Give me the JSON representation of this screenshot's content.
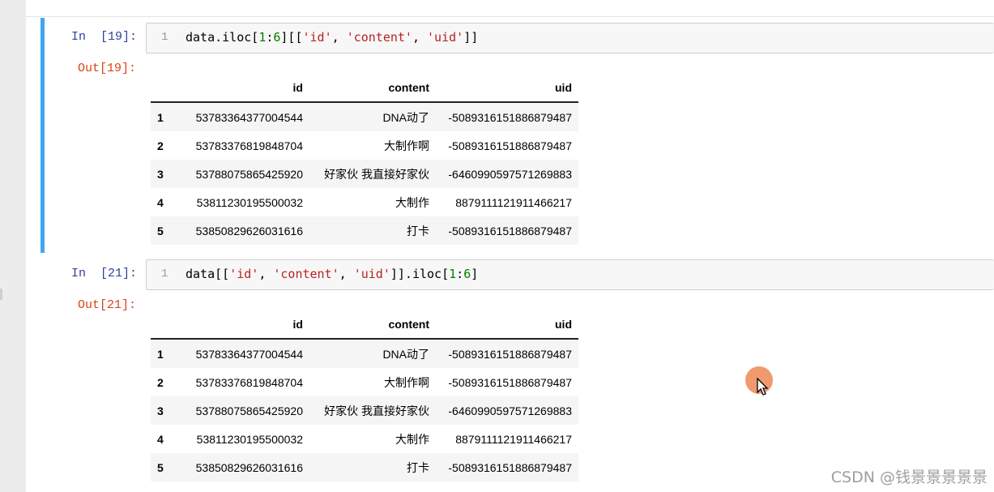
{
  "cells": [
    {
      "in_prompt": "In  [19]:",
      "line_number": "1",
      "code_tokens": [
        {
          "t": "data.iloc[",
          "k": "plain"
        },
        {
          "t": "1",
          "k": "num"
        },
        {
          "t": ":",
          "k": "plain"
        },
        {
          "t": "6",
          "k": "num"
        },
        {
          "t": "][[",
          "k": "plain"
        },
        {
          "t": "'id'",
          "k": "str"
        },
        {
          "t": ", ",
          "k": "plain"
        },
        {
          "t": "'content'",
          "k": "str"
        },
        {
          "t": ", ",
          "k": "plain"
        },
        {
          "t": "'uid'",
          "k": "str"
        },
        {
          "t": "]]",
          "k": "plain"
        }
      ],
      "out_prompt": "Out[19]:",
      "columns": [
        "id",
        "content",
        "uid"
      ],
      "rows": [
        {
          "index": "1",
          "id": "53783364377004544",
          "content": "DNA动了",
          "uid": "-5089316151886879487"
        },
        {
          "index": "2",
          "id": "53783376819848704",
          "content": "大制作啊",
          "uid": "-5089316151886879487"
        },
        {
          "index": "3",
          "id": "53788075865425920",
          "content": "好家伙 我直接好家伙",
          "uid": "-6460990597571269883"
        },
        {
          "index": "4",
          "id": "53811230195500032",
          "content": "大制作",
          "uid": "8879111121911466217"
        },
        {
          "index": "5",
          "id": "53850829626031616",
          "content": "打卡",
          "uid": "-5089316151886879487"
        }
      ]
    },
    {
      "in_prompt": "In  [21]:",
      "line_number": "1",
      "code_tokens": [
        {
          "t": "data[[",
          "k": "plain"
        },
        {
          "t": "'id'",
          "k": "str"
        },
        {
          "t": ", ",
          "k": "plain"
        },
        {
          "t": "'content'",
          "k": "str"
        },
        {
          "t": ", ",
          "k": "plain"
        },
        {
          "t": "'uid'",
          "k": "str"
        },
        {
          "t": "]].iloc[",
          "k": "plain"
        },
        {
          "t": "1",
          "k": "num"
        },
        {
          "t": ":",
          "k": "plain"
        },
        {
          "t": "6",
          "k": "num"
        },
        {
          "t": "]",
          "k": "plain"
        }
      ],
      "out_prompt": "Out[21]:",
      "columns": [
        "id",
        "content",
        "uid"
      ],
      "rows": [
        {
          "index": "1",
          "id": "53783364377004544",
          "content": "DNA动了",
          "uid": "-5089316151886879487"
        },
        {
          "index": "2",
          "id": "53783376819848704",
          "content": "大制作啊",
          "uid": "-5089316151886879487"
        },
        {
          "index": "3",
          "id": "53788075865425920",
          "content": "好家伙 我直接好家伙",
          "uid": "-6460990597571269883"
        },
        {
          "index": "4",
          "id": "53811230195500032",
          "content": "大制作",
          "uid": "8879111121911466217"
        },
        {
          "index": "5",
          "id": "53850829626031616",
          "content": "打卡",
          "uid": "-5089316151886879487"
        }
      ]
    }
  ],
  "watermark": "CSDN @钱景景景景景",
  "colors": {
    "selected_bar": "#42a5f5",
    "in_prompt": "#303f9f",
    "out_prompt": "#d84315",
    "string": "#ba2121",
    "number": "#008000"
  }
}
